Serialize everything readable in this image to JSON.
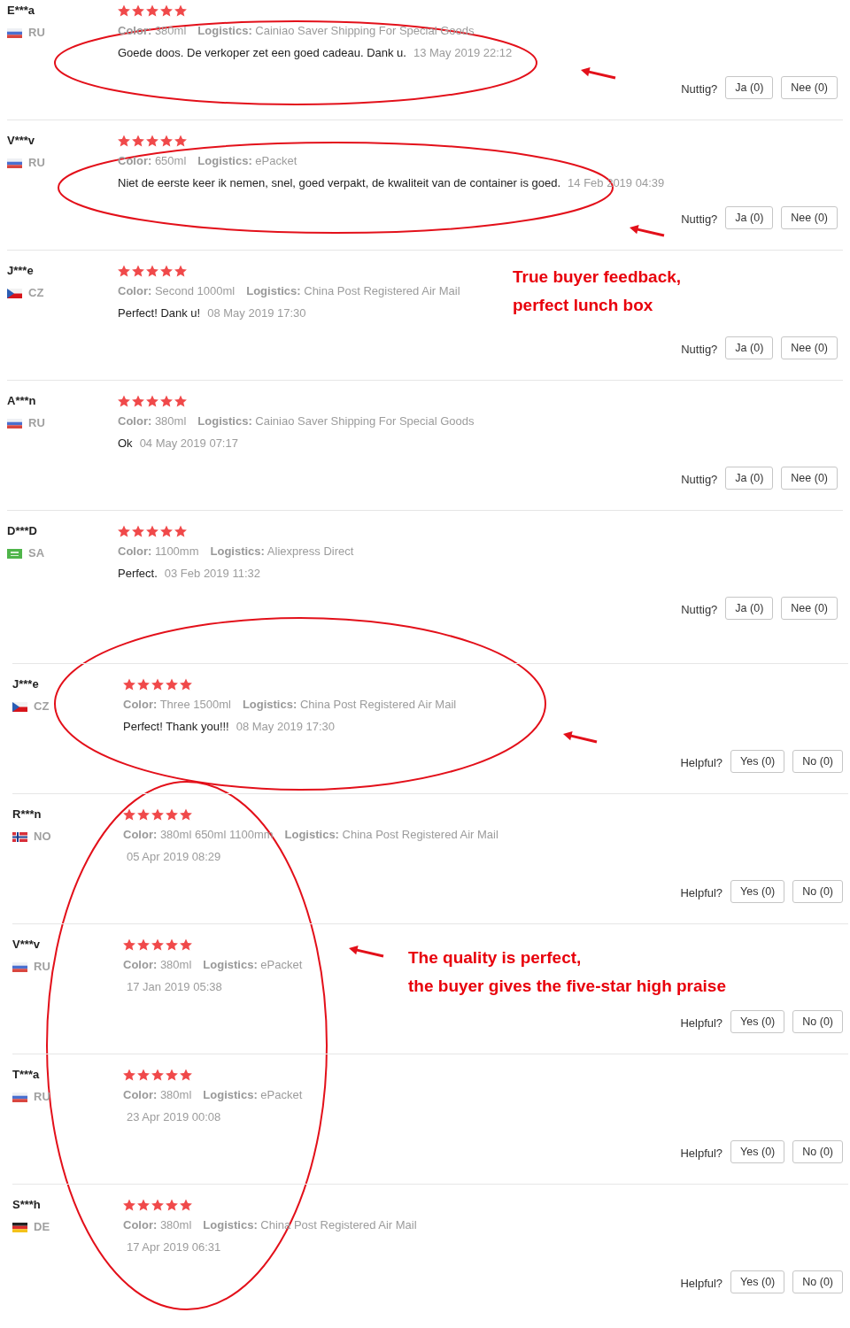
{
  "panels": [
    {
      "reviews": [
        {
          "reviewer": "E***a",
          "flag": {
            "kind": "white-blue-red"
          },
          "country": "RU",
          "stars": 5,
          "attributes": [
            "**Color:** 380ml",
            "**Logistics:** Cainiao Saver Shipping For Special Goods"
          ],
          "text": "Goede doos. De verkoper zet een goed cadeau. Dank u.",
          "date": "13 May 2019 22:12",
          "helpful": {
            "label": "Nuttig?",
            "buttons": [
              "Ja (0)",
              "Nee (0)"
            ]
          }
        },
        {
          "reviewer": "V***v",
          "flag": {
            "kind": "white-blue-red"
          },
          "country": "RU",
          "stars": 5,
          "attributes": [
            "**Color:** 650ml",
            "**Logistics:** ePacket"
          ],
          "text": "Niet de eerste keer ik nemen, snel, goed verpakt, de kwaliteit van de container is goed.",
          "date": "14 Feb 2019 04:39",
          "helpful": {
            "label": "Nuttig?",
            "buttons": [
              "Ja (0)",
              "Nee (0)"
            ]
          }
        },
        {
          "reviewer": "J***e",
          "flag": {
            "kind": "white-red-triangle"
          },
          "country": "CZ",
          "stars": 5,
          "attributes": [
            "**Color:** Second 1000ml",
            "**Logistics:** China Post Registered Air Mail"
          ],
          "text": "Perfect! Dank u!",
          "date": "08 May 2019 17:30",
          "helpful": {
            "label": "Nuttig?",
            "buttons": [
              "Ja (0)",
              "Nee (0)"
            ]
          }
        },
        {
          "reviewer": "A***n",
          "flag": {
            "kind": "white-blue-red"
          },
          "country": "RU",
          "stars": 5,
          "attributes": [
            "**Color:** 380ml",
            "**Logistics:** Cainiao Saver Shipping For Special Goods"
          ],
          "text": "Ok",
          "date": "04 May 2019 07:17",
          "helpful": {
            "label": "Nuttig?",
            "buttons": [
              "Ja (0)",
              "Nee (0)"
            ]
          }
        },
        {
          "reviewer": "D***D",
          "flag": {
            "kind": "green"
          },
          "country": "SA",
          "stars": 5,
          "attributes": [
            "**Color:** 1100mm",
            "**Logistics:** Aliexpress Direct"
          ],
          "text": "Perfect.",
          "date": "03 Feb 2019 11:32",
          "helpful": {
            "label": "Nuttig?",
            "buttons": [
              "Ja (0)",
              "Nee (0)"
            ]
          }
        }
      ]
    },
    {
      "reviews": [
        {
          "reviewer": "J***e",
          "flag": {
            "kind": "white-red-triangle"
          },
          "country": "CZ",
          "stars": 5,
          "attributes": [
            "**Color:** Three 1500ml",
            "**Logistics:** China Post Registered Air Mail"
          ],
          "text": "Perfect! Thank you!!!",
          "date": "08 May 2019 17:30",
          "helpful": {
            "label": "Helpful?",
            "buttons": [
              "Yes (0)",
              "No (0)"
            ]
          }
        },
        {
          "reviewer": "R***n",
          "flag": {
            "kind": "nordic-cross"
          },
          "country": "NO",
          "stars": 5,
          "attributes": [
            "**Color:** 380ml 650ml 1100mm",
            "**Logistics:** China Post Registered Air Mail"
          ],
          "date": "05 Apr 2019 08:29",
          "helpful": {
            "label": "Helpful?",
            "buttons": [
              "Yes (0)",
              "No (0)"
            ]
          }
        },
        {
          "reviewer": "V***v",
          "flag": {
            "kind": "white-blue-red"
          },
          "country": "RU",
          "stars": 5,
          "attributes": [
            "**Color:** 380ml",
            "**Logistics:** ePacket"
          ],
          "date": "17 Jan 2019 05:38",
          "helpful": {
            "label": "Helpful?",
            "buttons": [
              "Yes (0)",
              "No (0)"
            ]
          }
        },
        {
          "reviewer": "T***a",
          "flag": {
            "kind": "white-blue-red"
          },
          "country": "RU",
          "stars": 5,
          "attributes": [
            "**Color:** 380ml",
            "**Logistics:** ePacket"
          ],
          "date": "23 Apr 2019 00:08",
          "helpful": {
            "label": "Helpful?",
            "buttons": [
              "Yes (0)",
              "No (0)"
            ]
          }
        },
        {
          "reviewer": "S***h",
          "flag": {
            "kind": "black-red-gold"
          },
          "country": "DE",
          "stars": 5,
          "attributes": [
            "**Color:** 380ml",
            "**Logistics:** China Post Registered Air Mail"
          ],
          "date": "17 Apr 2019 06:31",
          "helpful": {
            "label": "Helpful?",
            "buttons": [
              "Yes (0)",
              "No (0)"
            ]
          }
        }
      ]
    }
  ],
  "annotations": [
    {
      "lines": [
        "True buyer feedback,",
        "perfect lunch box"
      ]
    },
    {
      "lines": [
        "The quality is perfect,",
        "the buyer gives the five-star high praise"
      ]
    }
  ]
}
